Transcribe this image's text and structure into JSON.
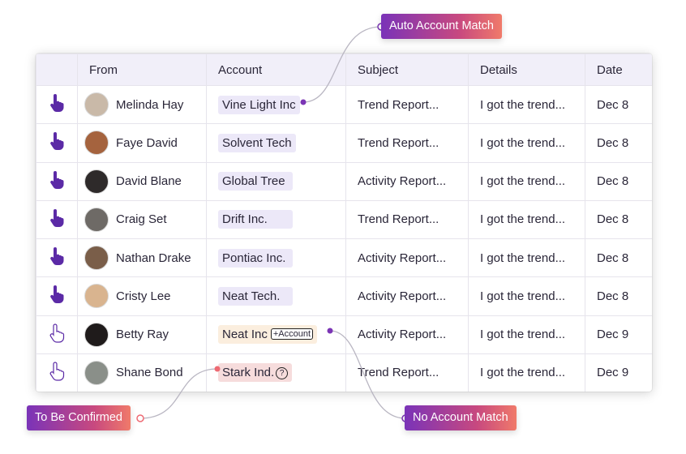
{
  "columns": [
    "",
    "From",
    "Account",
    "Subject",
    "Details",
    "Date"
  ],
  "rows": [
    {
      "from": "Melinda Hay",
      "account": "Vine Light Inc",
      "subject": "Trend Report...",
      "details": "I got the trend...",
      "date": "Dec 8",
      "action_icon": "hand-pointer-filled-icon",
      "avatar_color": "#c9b9a8",
      "account_state": "matched"
    },
    {
      "from": "Faye David",
      "account": "Solvent Tech",
      "subject": "Trend Report...",
      "details": "I got the trend...",
      "date": "Dec 8",
      "action_icon": "hand-pointer-filled-icon",
      "avatar_color": "#a5633e",
      "account_state": "matched"
    },
    {
      "from": "David Blane",
      "account": "Global Tree",
      "subject": "Activity Report...",
      "details": "I got the trend...",
      "date": "Dec 8",
      "action_icon": "hand-pointer-filled-icon",
      "avatar_color": "#2e2a2a",
      "account_state": "matched"
    },
    {
      "from": "Craig Set",
      "account": "Drift Inc.",
      "subject": "Trend Report...",
      "details": "I got the trend...",
      "date": "Dec 8",
      "action_icon": "hand-pointer-filled-icon",
      "avatar_color": "#6e6a66",
      "account_state": "matched"
    },
    {
      "from": "Nathan Drake",
      "account": "Pontiac Inc.",
      "subject": "Activity Report...",
      "details": "I got the trend...",
      "date": "Dec 8",
      "action_icon": "hand-pointer-filled-icon",
      "avatar_color": "#7a5e49",
      "account_state": "matched"
    },
    {
      "from": "Cristy Lee",
      "account": "Neat Tech.",
      "subject": "Activity Report...",
      "details": "I got the trend...",
      "date": "Dec 8",
      "action_icon": "hand-pointer-filled-icon",
      "avatar_color": "#d9b48f",
      "account_state": "matched"
    },
    {
      "from": "Betty Ray",
      "account": "Neat Inc",
      "account_button": "+Account",
      "subject": "Activity Report...",
      "details": "I got the trend...",
      "date": "Dec 9",
      "action_icon": "hand-pointer-outline-icon",
      "avatar_color": "#1f1b1b",
      "account_state": "no-match"
    },
    {
      "from": "Shane Bond",
      "account": "Stark Ind.",
      "account_badge": "?",
      "subject": "Trend Report...",
      "details": "I got the trend...",
      "date": "Dec 9",
      "action_icon": "hand-pointer-outline-icon",
      "avatar_color": "#8a8f89",
      "account_state": "to-confirm"
    }
  ],
  "callouts": {
    "auto_match": "Auto Account Match",
    "no_match": "No Account Match",
    "to_be_confirmed": "To Be Confirmed"
  },
  "colors": {
    "accent_purple": "#5b2aa6",
    "connector_dot_purple": "#7b35b5",
    "connector_dot_coral": "#ee6a73",
    "pill_matched": "#ece8f8",
    "pill_no_match": "#fbeede",
    "pill_to_confirm": "#f6dcdc"
  }
}
